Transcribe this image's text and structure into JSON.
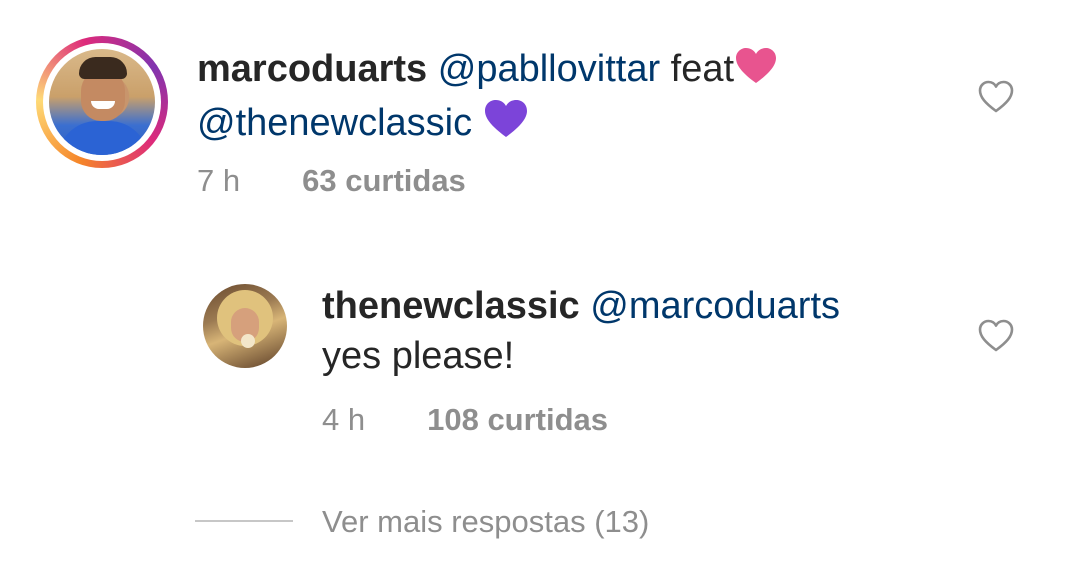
{
  "comment": {
    "username": "marcoduarts",
    "mention_1": "@pabllovittar",
    "text_1": " feat",
    "mention_2": "@thenewclassic",
    "time": "7 h",
    "likes": "63 curtidas"
  },
  "reply": {
    "username": "thenewclassic",
    "mention": "@marcoduarts",
    "text": "yes please!",
    "time": "4 h",
    "likes": "108 curtidas"
  },
  "more_replies": {
    "label": "Ver mais respostas (13)"
  },
  "icons": {
    "like": "heart-outline-icon",
    "pink_heart": "pink-heart-emoji",
    "purple_heart": "purple-heart-emoji"
  },
  "colors": {
    "username": "#262626",
    "mention": "#00376b",
    "meta": "#8e8e8e",
    "pink_heart": "#e8548f",
    "purple_heart": "#7c44d9",
    "like_outline": "#8e8e8e"
  }
}
